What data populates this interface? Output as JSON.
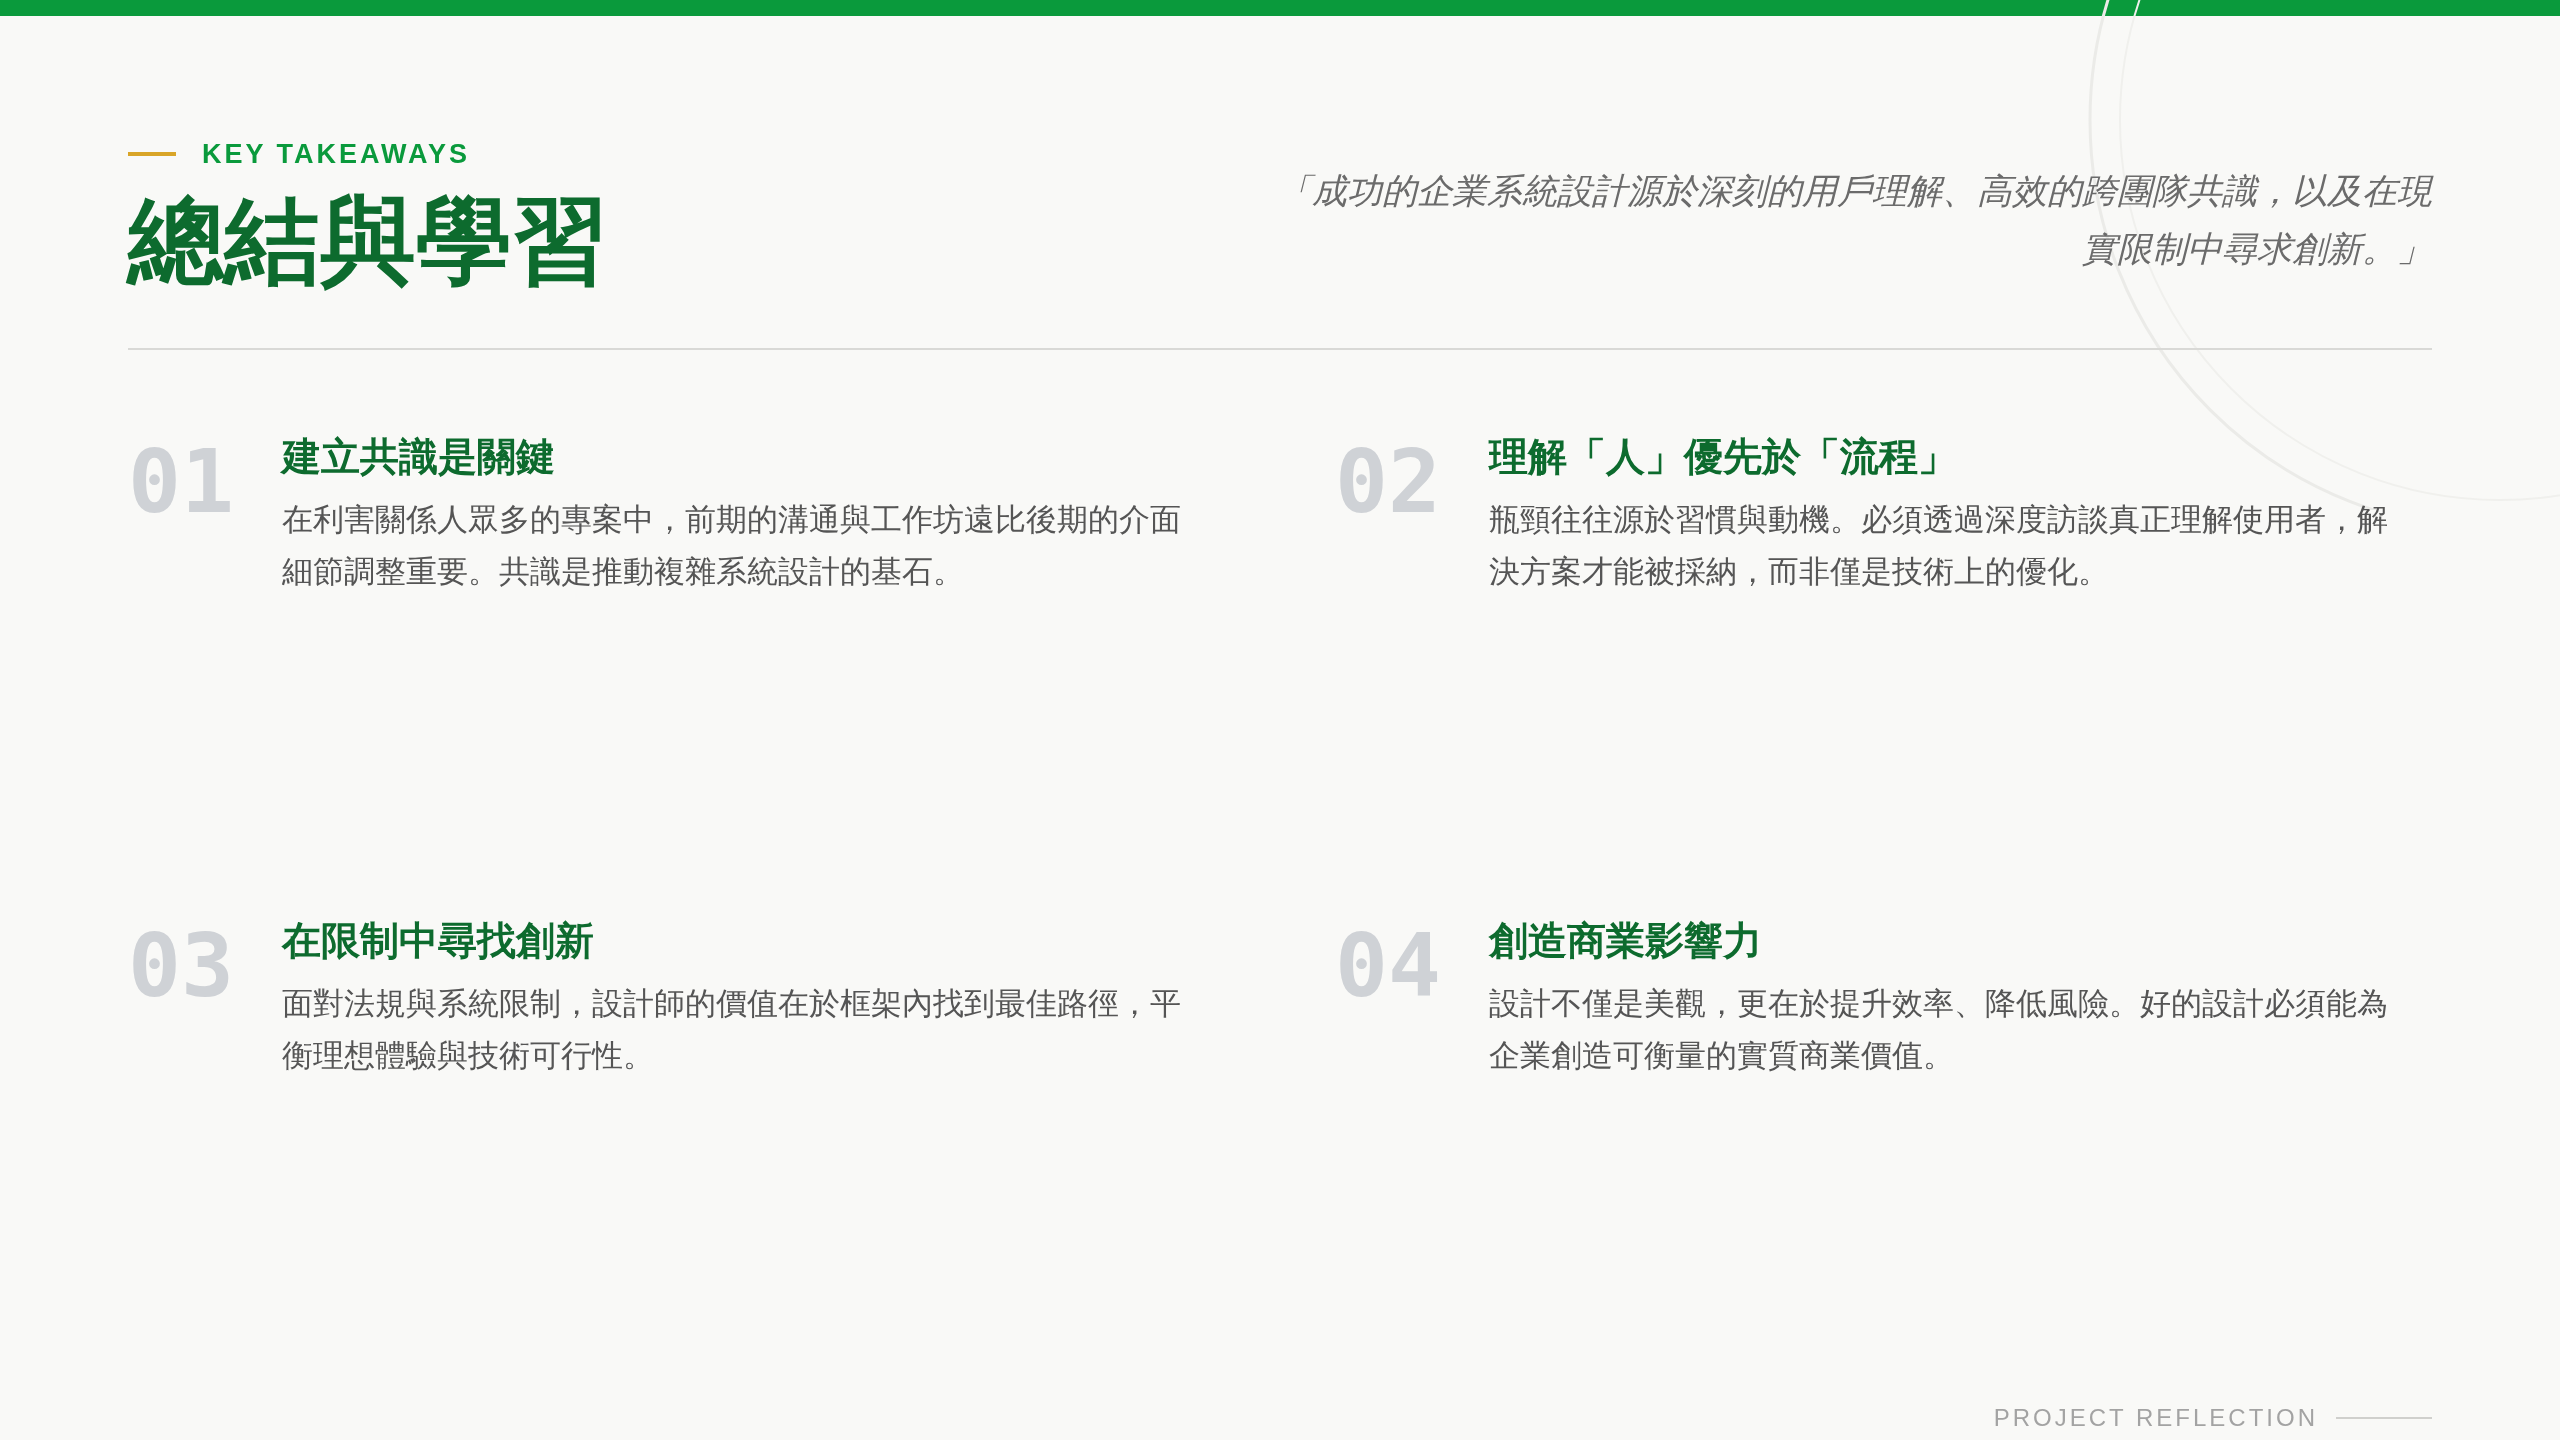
{
  "header": {
    "eyebrow": "KEY TAKEAWAYS",
    "title": "總結與學習",
    "quote": "「成功的企業系統設計源於深刻的用戶理解、高效的跨團隊共識，以及在現實限制中尋求創新。」"
  },
  "takeaways": [
    {
      "number": "01",
      "title": "建立共識是關鍵",
      "body": "在利害關係人眾多的專案中，前期的溝通與工作坊遠比後期的介面細節調整重要。共識是推動複雜系統設計的基石。"
    },
    {
      "number": "02",
      "title": "理解「人」優先於「流程」",
      "body": "瓶頸往往源於習慣與動機。必須透過深度訪談真正理解使用者，解決方案才能被採納，而非僅是技術上的優化。"
    },
    {
      "number": "03",
      "title": "在限制中尋找創新",
      "body": "面對法規與系統限制，設計師的價值在於框架內找到最佳路徑，平衡理想體驗與技術可行性。"
    },
    {
      "number": "04",
      "title": "創造商業影響力",
      "body": "設計不僅是美觀，更在於提升效率、降低風險。好的設計必須能為企業創造可衡量的實質商業價值。"
    }
  ],
  "footer": {
    "label": "PROJECT REFLECTION"
  }
}
